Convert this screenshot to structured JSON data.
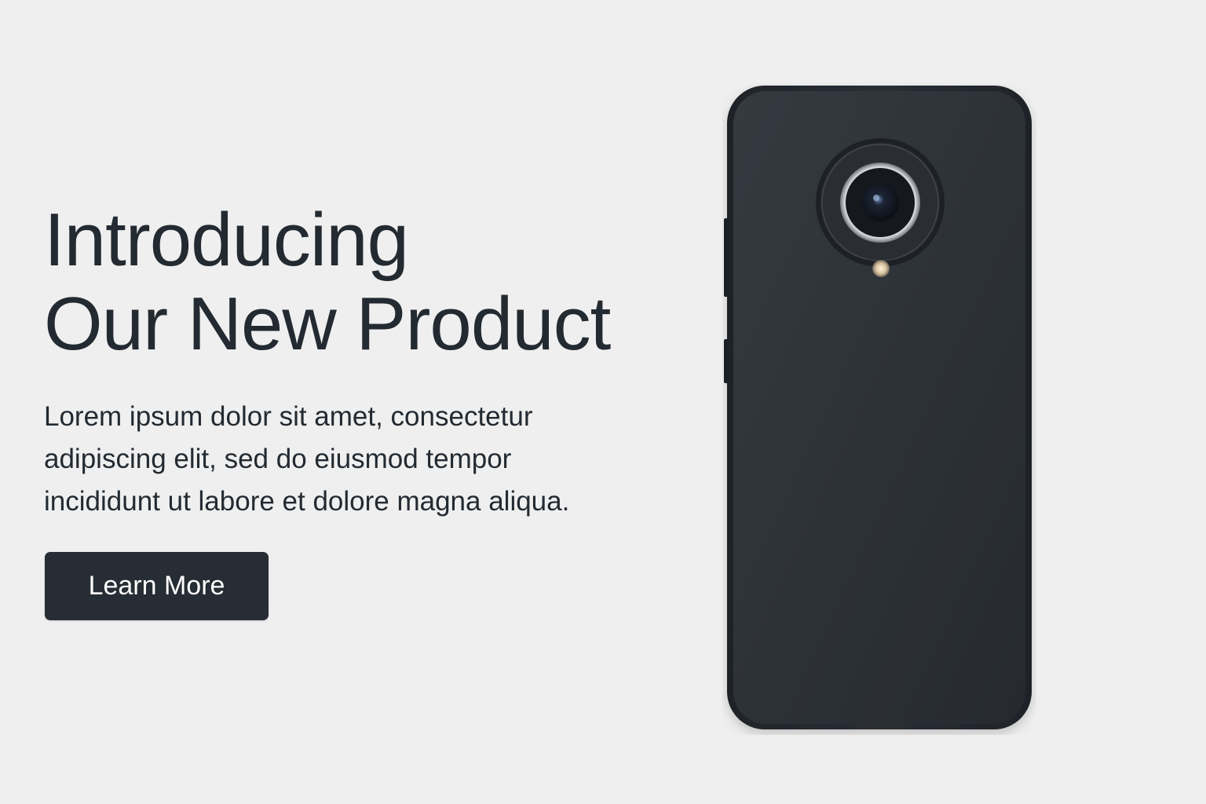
{
  "hero": {
    "headline_line1": "Introducing",
    "headline_line2": "Our New Product",
    "body": "Lorem ipsum dolor sit amet, consectetur adipiscing elit, sed do eiusmod tempor incididunt ut labore et dolore magna aliqua.",
    "cta_label": "Learn More"
  },
  "product": {
    "icon": "smartphone-back-with-camera"
  },
  "colors": {
    "background": "#efefef",
    "text": "#232a31",
    "button": "#262d34",
    "phone_body": "#2d3238"
  }
}
